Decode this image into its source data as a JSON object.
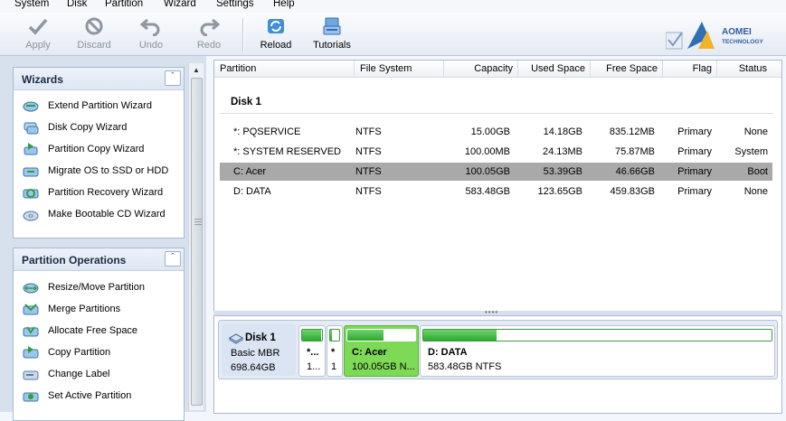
{
  "menu": [
    "System",
    "Disk",
    "Partition",
    "Wizard",
    "Settings",
    "Help"
  ],
  "toolbar": {
    "apply": "Apply",
    "discard": "Discard",
    "undo": "Undo",
    "redo": "Redo",
    "reload": "Reload",
    "tutorials": "Tutorials"
  },
  "logo": {
    "line1": "AOMEI",
    "line2": "TECHNOLOGY"
  },
  "wizards": {
    "title": "Wizards",
    "items": [
      {
        "label": "Extend Partition Wizard",
        "icon": "extend-partition-icon"
      },
      {
        "label": "Disk Copy Wizard",
        "icon": "disk-copy-icon"
      },
      {
        "label": "Partition Copy Wizard",
        "icon": "partition-copy-icon"
      },
      {
        "label": "Migrate OS to SSD or HDD",
        "icon": "migrate-os-icon"
      },
      {
        "label": "Partition Recovery Wizard",
        "icon": "partition-recovery-icon"
      },
      {
        "label": "Make Bootable CD Wizard",
        "icon": "bootable-cd-icon"
      }
    ]
  },
  "operations": {
    "title": "Partition Operations",
    "items": [
      {
        "label": "Resize/Move Partition",
        "icon": "resize-move-icon"
      },
      {
        "label": "Merge Partitions",
        "icon": "merge-icon"
      },
      {
        "label": "Allocate Free Space",
        "icon": "allocate-icon"
      },
      {
        "label": "Copy Partition",
        "icon": "copy-partition-icon"
      },
      {
        "label": "Change Label",
        "icon": "change-label-icon"
      },
      {
        "label": "Set Active Partition",
        "icon": "set-active-icon"
      }
    ]
  },
  "table": {
    "columns": [
      "Partition",
      "File System",
      "Capacity",
      "Used Space",
      "Free Space",
      "Flag",
      "Status"
    ],
    "disk_label": "Disk 1",
    "rows": [
      {
        "partition": "*: PQSERVICE",
        "fs": "NTFS",
        "capacity": "15.00GB",
        "used": "14.18GB",
        "free": "835.12MB",
        "flag": "Primary",
        "status": "None"
      },
      {
        "partition": "*: SYSTEM RESERVED",
        "fs": "NTFS",
        "capacity": "100.00MB",
        "used": "24.13MB",
        "free": "75.87MB",
        "flag": "Primary",
        "status": "System"
      },
      {
        "partition": "C: Acer",
        "fs": "NTFS",
        "capacity": "100.05GB",
        "used": "53.39GB",
        "free": "46.66GB",
        "flag": "Primary",
        "status": "Boot"
      },
      {
        "partition": "D: DATA",
        "fs": "NTFS",
        "capacity": "583.48GB",
        "used": "123.65GB",
        "free": "459.83GB",
        "flag": "Primary",
        "status": "None"
      }
    ],
    "selected_row": 2
  },
  "diskmap": {
    "name": "Disk 1",
    "type": "Basic MBR",
    "size": "698.64GB",
    "partitions": [
      {
        "l1": "*...",
        "l2": "1...",
        "used_fraction": 0.95
      },
      {
        "l1": "*",
        "l2": "1",
        "used_fraction": 0.24
      },
      {
        "l1": "C: Acer",
        "l2": "100.05GB N...",
        "used_fraction": 0.53
      },
      {
        "l1": "D: DATA",
        "l2": "583.48GB NTFS",
        "used_fraction": 0.21
      }
    ]
  }
}
